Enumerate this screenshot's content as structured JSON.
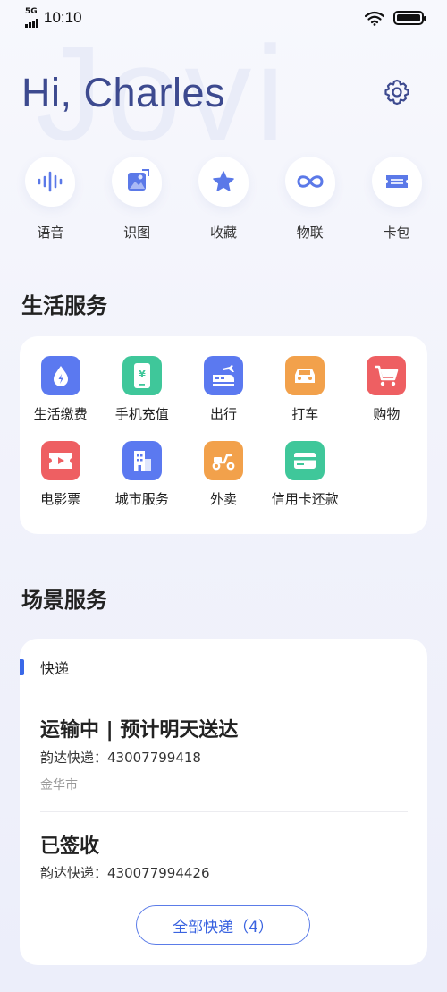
{
  "status_bar": {
    "network": "5G",
    "time": "10:10"
  },
  "header": {
    "greeting": "Hi, Charles",
    "watermark": "Jovi"
  },
  "quick_actions": [
    {
      "label": "语音",
      "icon": "voice-wave-icon"
    },
    {
      "label": "识图",
      "icon": "image-scan-icon"
    },
    {
      "label": "收藏",
      "icon": "star-icon"
    },
    {
      "label": "物联",
      "icon": "infinity-icon"
    },
    {
      "label": "卡包",
      "icon": "card-ticket-icon"
    }
  ],
  "life_services": {
    "title": "生活服务",
    "items": [
      {
        "label": "生活缴费",
        "icon": "water-drop-icon",
        "color": "#5b79f0"
      },
      {
        "label": "手机充值",
        "icon": "phone-recharge-icon",
        "color": "#3fc79a"
      },
      {
        "label": "出行",
        "icon": "train-plane-icon",
        "color": "#5b79f0"
      },
      {
        "label": "打车",
        "icon": "taxi-icon",
        "color": "#f2a14b"
      },
      {
        "label": "购物",
        "icon": "shopping-cart-icon",
        "color": "#ee5f62"
      },
      {
        "label": "电影票",
        "icon": "movie-ticket-icon",
        "color": "#ee5f62"
      },
      {
        "label": "城市服务",
        "icon": "city-building-icon",
        "color": "#5b79f0"
      },
      {
        "label": "外卖",
        "icon": "scooter-icon",
        "color": "#f2a14b"
      },
      {
        "label": "信用卡还款",
        "icon": "credit-card-icon",
        "color": "#3fc79a"
      }
    ]
  },
  "scene_services": {
    "title": "场景服务",
    "express": {
      "title": "快递",
      "packages": [
        {
          "status": "运输中 | 预计明天送达",
          "tracking": "韵达快递：43007799418",
          "city": "金华市"
        },
        {
          "status": "已签收",
          "tracking": "韵达快递：430077994426",
          "city": ""
        }
      ],
      "all_button": "全部快递（4）"
    }
  },
  "colors": {
    "accent": "#3a63e0",
    "greeting": "#3d4a8f",
    "quick_icon": "#5b79e8"
  }
}
